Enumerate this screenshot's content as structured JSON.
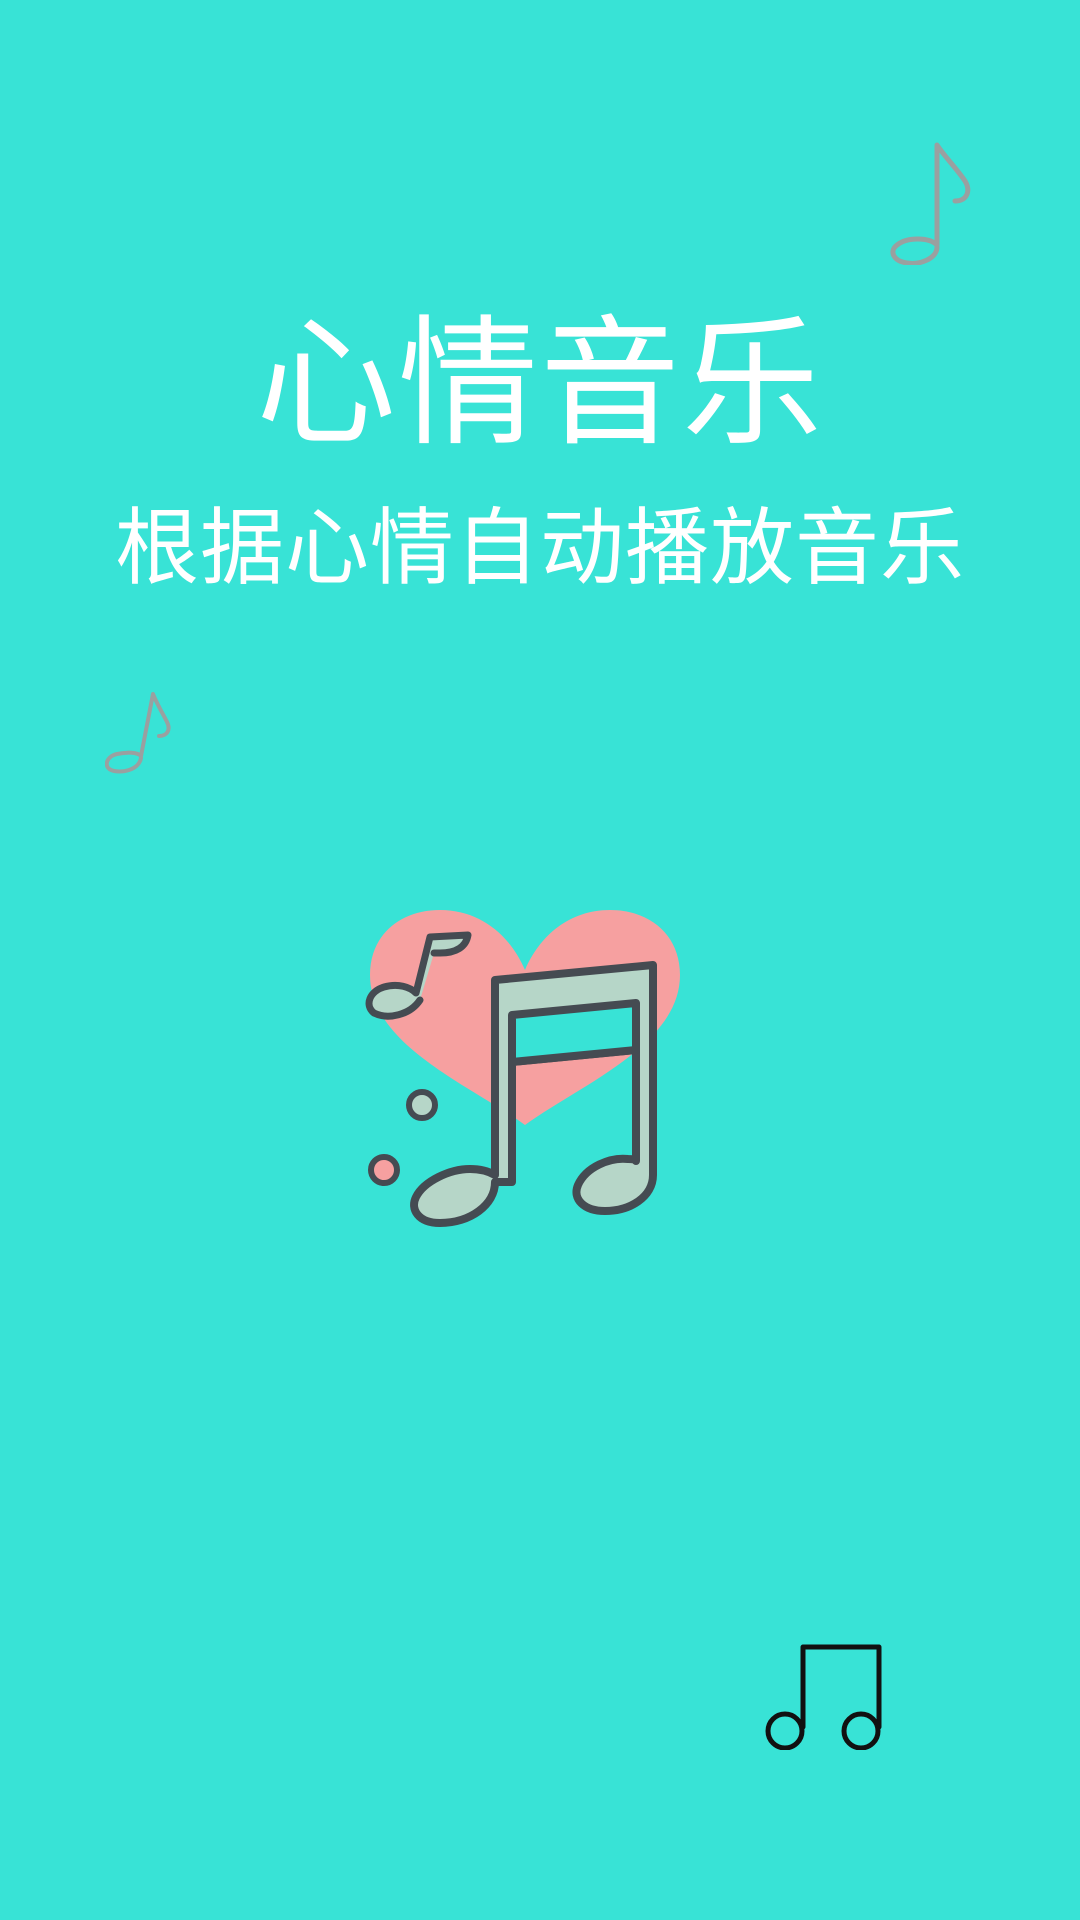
{
  "app": {
    "title": "心情音乐",
    "subtitle": "根据心情自动播放音乐"
  },
  "icons": {
    "top_right": "music-note-icon",
    "left": "music-note-icon",
    "center_logo": "heart-music-note-logo",
    "bottom_right": "beamed-music-notes-icon"
  },
  "colors": {
    "background": "#38E3D6",
    "text": "#FFFFFF",
    "heart": "#F6A0A0",
    "note_fill": "#B6D6C8",
    "note_stroke": "#454B52",
    "decor_note": "#9AA0A0"
  }
}
